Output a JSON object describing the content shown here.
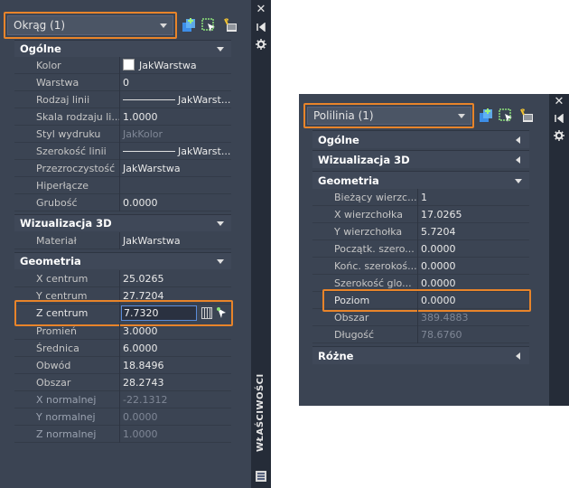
{
  "left_panel": {
    "object_selector": "Okrąg (1)",
    "palette_title": "WŁAŚCIWOŚCI",
    "sections": [
      {
        "title": "Ogólne",
        "rows": [
          {
            "label": "Kolor",
            "value": "JakWarstwa"
          },
          {
            "label": "Warstwa",
            "value": "0"
          },
          {
            "label": "Rodzaj linii",
            "value": "JakWarst..."
          },
          {
            "label": "Skala rodzaju li...",
            "value": "1.0000"
          },
          {
            "label": "Styl wydruku",
            "value": "JakKolor"
          },
          {
            "label": "Szerokość linii",
            "value": "JakWarst..."
          },
          {
            "label": "Przezroczystość",
            "value": "JakWarstwa"
          },
          {
            "label": "Hiperłącze",
            "value": ""
          },
          {
            "label": "Grubość",
            "value": "0.0000"
          }
        ]
      },
      {
        "title": "Wizualizacja 3D",
        "rows": [
          {
            "label": "Materiał",
            "value": "JakWarstwa"
          }
        ]
      },
      {
        "title": "Geometria",
        "rows": [
          {
            "label": "X centrum",
            "value": "25.0265"
          },
          {
            "label": "Y centrum",
            "value": "27.7204"
          },
          {
            "label": "Z centrum",
            "value": "7.7320"
          },
          {
            "label": "Promień",
            "value": "3.0000"
          },
          {
            "label": "Średnica",
            "value": "6.0000"
          },
          {
            "label": "Obwód",
            "value": "18.8496"
          },
          {
            "label": "Obszar",
            "value": "28.2743"
          },
          {
            "label": "X normalnej",
            "value": "-22.1312"
          },
          {
            "label": "Y normalnej",
            "value": "0.0000"
          },
          {
            "label": "Z normalnej",
            "value": "1.0000"
          }
        ]
      }
    ]
  },
  "right_panel": {
    "object_selector": "Polilinia (1)",
    "collapsed_top": [
      "Ogólne",
      "Wizualizacja 3D"
    ],
    "geometry_title": "Geometria",
    "rows": [
      {
        "label": "Bieżący wierzc...",
        "value": "1"
      },
      {
        "label": "X wierzchołka",
        "value": "17.0265"
      },
      {
        "label": "Y wierzchołka",
        "value": "5.7204"
      },
      {
        "label": "Początk. szero...",
        "value": "0.0000"
      },
      {
        "label": "Końc. szerokoś...",
        "value": "0.0000"
      },
      {
        "label": "Szerokość glo...",
        "value": "0.0000"
      },
      {
        "label": "Poziom",
        "value": "0.0000"
      },
      {
        "label": "Obszar",
        "value": "389.4883"
      },
      {
        "label": "Długość",
        "value": "78.6760"
      }
    ],
    "collapsed_bottom": "Różne"
  },
  "colors": {
    "highlight": "#e8842a",
    "panel_bg": "#3b4453",
    "side_strip": "#252c38"
  }
}
